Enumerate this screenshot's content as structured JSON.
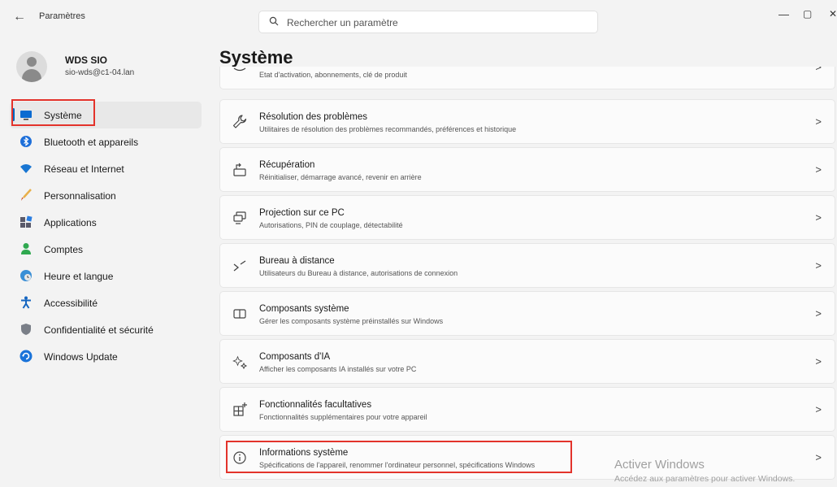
{
  "window": {
    "title": "Paramètres",
    "back_glyph": "←",
    "minimize_glyph": "—",
    "restore_glyph": "▢",
    "close_glyph": "✕"
  },
  "search": {
    "placeholder": "Rechercher un paramètre",
    "value": "",
    "icon": "search-icon"
  },
  "user": {
    "name": "WDS SIO",
    "email": "sio-wds@c1-04.lan"
  },
  "sidebar": {
    "items": [
      {
        "label": "Système",
        "icon": "monitor-icon",
        "active": true,
        "highlighted": true
      },
      {
        "label": "Bluetooth et appareils",
        "icon": "bluetooth-icon"
      },
      {
        "label": "Réseau et Internet",
        "icon": "wifi-icon"
      },
      {
        "label": "Personnalisation",
        "icon": "brush-icon"
      },
      {
        "label": "Applications",
        "icon": "apps-icon"
      },
      {
        "label": "Comptes",
        "icon": "person-icon"
      },
      {
        "label": "Heure et langue",
        "icon": "globe-clock-icon"
      },
      {
        "label": "Accessibilité",
        "icon": "accessibility-icon"
      },
      {
        "label": "Confidentialité et sécurité",
        "icon": "shield-icon"
      },
      {
        "label": "Windows Update",
        "icon": "update-icon"
      }
    ]
  },
  "main": {
    "title": "Système",
    "chevron": ">",
    "cards": [
      {
        "title": "",
        "subtitle": "Etat d'activation, abonnements, clé de produit",
        "icon": "activation-icon"
      },
      {
        "title": "Résolution des problèmes",
        "subtitle": "Utilitaires de résolution des problèmes recommandés, préférences et historique",
        "icon": "wrench-icon"
      },
      {
        "title": "Récupération",
        "subtitle": "Réinitialiser, démarrage avancé, revenir en arrière",
        "icon": "recovery-icon"
      },
      {
        "title": "Projection sur ce PC",
        "subtitle": "Autorisations, PIN de couplage, détectabilité",
        "icon": "projection-icon"
      },
      {
        "title": "Bureau à distance",
        "subtitle": "Utilisateurs du Bureau à distance, autorisations de connexion",
        "icon": "remote-desktop-icon"
      },
      {
        "title": "Composants système",
        "subtitle": "Gérer les composants système préinstallés sur Windows",
        "icon": "system-components-icon"
      },
      {
        "title": "Composants d'IA",
        "subtitle": "Afficher les composants IA installés sur votre PC",
        "icon": "ai-sparkle-icon"
      },
      {
        "title": "Fonctionnalités facultatives",
        "subtitle": "Fonctionnalités supplémentaires pour votre appareil",
        "icon": "optional-features-icon"
      },
      {
        "title": "Informations système",
        "subtitle": "Spécifications de l'appareil, renommer l'ordinateur personnel, spécifications Windows",
        "icon": "info-icon",
        "highlighted": true
      }
    ]
  },
  "watermark": {
    "line1": "Activer Windows",
    "line2": "Accédez aux paramètres pour activer Windows."
  },
  "colors": {
    "accent": "#0067c0",
    "highlight_box": "#e3332b",
    "background": "#f3f3f3",
    "card": "#fbfbfb"
  }
}
